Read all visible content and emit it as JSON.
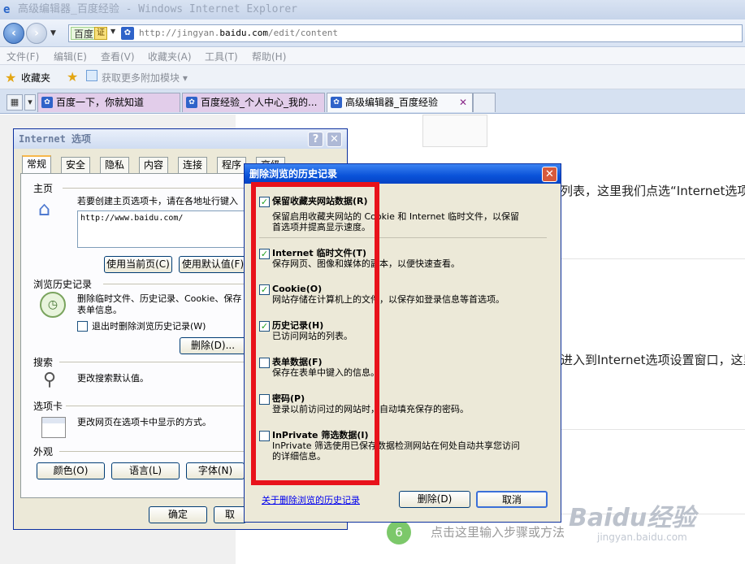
{
  "window": {
    "title": "高级编辑器_百度经验 - Windows Internet Explorer",
    "address_brand": "百度",
    "address_cert": "证",
    "url_prefix": "http://jingyan.",
    "url_domain": "baidu.com",
    "url_suffix": "/edit/content"
  },
  "menu": [
    "文件(F)",
    "编辑(E)",
    "查看(V)",
    "收藏夹(A)",
    "工具(T)",
    "帮助(H)"
  ],
  "favorites": {
    "label": "收藏夹",
    "get_more": "获取更多附加模块"
  },
  "tabs": [
    {
      "label": "百度一下，你就知道",
      "active": false
    },
    {
      "label": "百度经验_个人中心_我的...",
      "active": false
    },
    {
      "label": "高级编辑器_百度经验",
      "active": true
    }
  ],
  "page": {
    "text1": "列表，这里我们点选“Internet选项",
    "text2": "进入到Internet选项设置窗口，这里",
    "step_number": "6",
    "step_hint": "点击这里输入步骤或方法",
    "watermark": "Baidu经验",
    "watermark_sub": "jingyan.baidu.com"
  },
  "internet_options": {
    "title": "Internet 选项",
    "help": "?",
    "close": "✕",
    "tabs": [
      "常规",
      "安全",
      "隐私",
      "内容",
      "连接",
      "程序",
      "高级"
    ],
    "home_group": "主页",
    "home_desc": "若要创建主页选项卡，请在各地址行键入",
    "home_url": "http://www.baidu.com/",
    "use_current": "使用当前页(C)",
    "use_default": "使用默认值(F)",
    "history_group": "浏览历史记录",
    "history_desc_1": "删除临时文件、历史记录、Cookie、保存",
    "history_desc_2": "表单信息。",
    "delete_on_exit": "退出时删除浏览历史记录(W)",
    "delete_button": "删除(D)...",
    "search_group": "搜索",
    "search_desc": "更改搜索默认值。",
    "tabs_group": "选项卡",
    "tabs_desc": "更改网页在选项卡中显示的方式。",
    "appearance_group": "外观",
    "colors": "颜色(O)",
    "languages": "语言(L)",
    "fonts": "字体(N)",
    "ok": "确定",
    "cancel": "取"
  },
  "delete_history": {
    "title": "删除浏览的历史记录",
    "close": "✕",
    "items": [
      {
        "checked": true,
        "title": "保留收藏夹网站数据(R)",
        "desc": [
          "保留启用收藏夹网站的 Cookie 和 Internet 临时文件，以保留",
          "首选项并提高显示速度。"
        ]
      },
      {
        "checked": true,
        "title": "Internet 临时文件(T)",
        "desc": [
          "保存网页、图像和媒体的副本，以便快速查看。"
        ]
      },
      {
        "checked": true,
        "title": "Cookie(O)",
        "desc": [
          "网站存储在计算机上的文件，以保存如登录信息等首选项。"
        ]
      },
      {
        "checked": true,
        "title": "历史记录(H)",
        "desc": [
          "已访问网站的列表。"
        ]
      },
      {
        "checked": false,
        "title": "表单数据(F)",
        "desc": [
          "保存在表单中键入的信息。"
        ]
      },
      {
        "checked": false,
        "title": "密码(P)",
        "desc": [
          "登录以前访问过的网站时，自动填充保存的密码。"
        ]
      },
      {
        "checked": false,
        "title": "InPrivate 筛选数据(I)",
        "desc": [
          "InPrivate 筛选使用已保存数据检测网站在何处自动共享您访问",
          "的详细信息。"
        ]
      }
    ],
    "about_link": "关于删除浏览的历史记录",
    "delete": "删除(D)",
    "cancel": "取消"
  }
}
